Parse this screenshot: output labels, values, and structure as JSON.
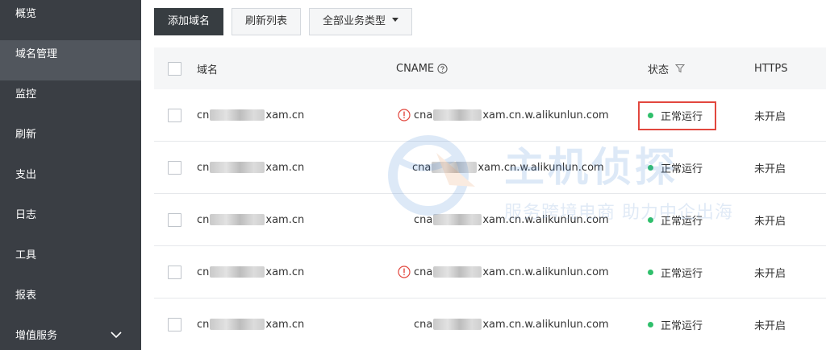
{
  "sidebar": {
    "items": [
      {
        "label": "概览"
      },
      {
        "label": "域名管理"
      },
      {
        "label": "监控"
      },
      {
        "label": "刷新"
      },
      {
        "label": "支出"
      },
      {
        "label": "日志"
      },
      {
        "label": "工具"
      },
      {
        "label": "报表"
      },
      {
        "label": "增值服务"
      }
    ],
    "active": "域名管理"
  },
  "toolbar": {
    "add_label": "添加域名",
    "refresh_label": "刷新列表",
    "type_filter_label": "全部业务类型"
  },
  "table": {
    "headers": {
      "domain": "域名",
      "cname": "CNAME",
      "status": "状态",
      "https": "HTTPS"
    },
    "rows": [
      {
        "domain_prefix": "cn",
        "domain_suffix": "xam.cn",
        "cname_prefix": "cna",
        "cname_suffix": "xam.cn.w.alikunlun.com",
        "warning": true,
        "status": "正常运行",
        "https": "未开启",
        "highlighted": true
      },
      {
        "domain_prefix": "cn",
        "domain_suffix": "xam.cn",
        "cname_prefix": "cna",
        "cname_suffix": "xam.cn.w.alikunlun.com",
        "warning": false,
        "status": "正常运行",
        "https": "未开启",
        "highlighted": false
      },
      {
        "domain_prefix": "cn",
        "domain_suffix": "xam.cn",
        "cname_prefix": "cna",
        "cname_suffix": "xam.cn.w.alikunlun.com",
        "warning": false,
        "status": "正常运行",
        "https": "未开启",
        "highlighted": false
      },
      {
        "domain_prefix": "cn",
        "domain_suffix": "xam.cn",
        "cname_prefix": "cna",
        "cname_suffix": "xam.cn.w.alikunlun.com",
        "warning": true,
        "status": "正常运行",
        "https": "未开启",
        "highlighted": false
      },
      {
        "domain_prefix": "cn",
        "domain_suffix": "xam.cn",
        "cname_prefix": "cna",
        "cname_suffix": "xam.cn.w.alikunlun.com",
        "warning": false,
        "status": "正常运行",
        "https": "未开启",
        "highlighted": false
      }
    ]
  },
  "watermark": {
    "line1": "主机侦探",
    "line2": "服务跨境电商 助力中企出海"
  },
  "colors": {
    "sidebar_bg": "#3a3e44",
    "sidebar_active": "#51565d",
    "primary_btn": "#373d41",
    "status_ok": "#2fbf6b",
    "highlight": "#e2473e",
    "warning": "#e2473e"
  }
}
